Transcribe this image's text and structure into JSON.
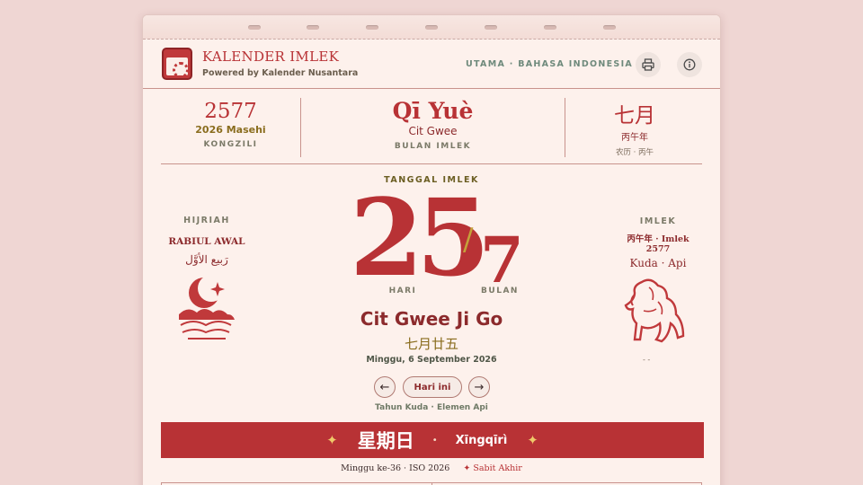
{
  "header": {
    "title": "KALENDER IMLEK",
    "subtitle": "Powered by Kalender Nusantara",
    "nav": "UTAMA · BAHASA INDONESIA",
    "print_icon": "printer-icon",
    "info_icon": "info-icon"
  },
  "summary": {
    "year": {
      "value": "2577",
      "sub": "2026 Masehi",
      "label": "KONGZILI"
    },
    "month": {
      "value": "Qī Yuè",
      "sub": "Cit Gwee",
      "label": "BULAN IMLEK"
    },
    "chinese": {
      "value": "七月",
      "sub": "丙午年",
      "label": "农历 · 丙午"
    }
  },
  "hijri": {
    "label": "HIJRIAH",
    "month": "RABIUL AWAL",
    "arabic": "رَبيع الأوَّل"
  },
  "date": {
    "label": "TANGGAL IMLEK",
    "day": "25",
    "slash": "/",
    "month": "7",
    "day_caption": "HARI",
    "month_caption": "BULAN",
    "name": "Cit Gwee Ji Go",
    "chinese": "七月廿五",
    "gregorian": "Minggu, 6 September 2026"
  },
  "controls": {
    "prev": "←",
    "today": "Hari ini",
    "next": "→"
  },
  "element_note": "Tahun Kuda · Elemen Api",
  "imlek": {
    "label": "IMLEK",
    "line1": "丙午年 · Imlek",
    "line2": "2577",
    "zodiac": "Kuda · Api",
    "dots": "- -"
  },
  "banner": {
    "star": "✦",
    "weekday": "星期日",
    "dot": "•",
    "pinyin": "Xīngqīrì"
  },
  "footer": {
    "week": "Minggu ke-36 · ISO 2026",
    "star": "✦",
    "sabbath": "Sabit Akhir"
  },
  "colors": {
    "accent": "#b83235",
    "gold": "#8a6d1e",
    "green_muted": "#6f8a7c",
    "background": "#efd6d3"
  }
}
